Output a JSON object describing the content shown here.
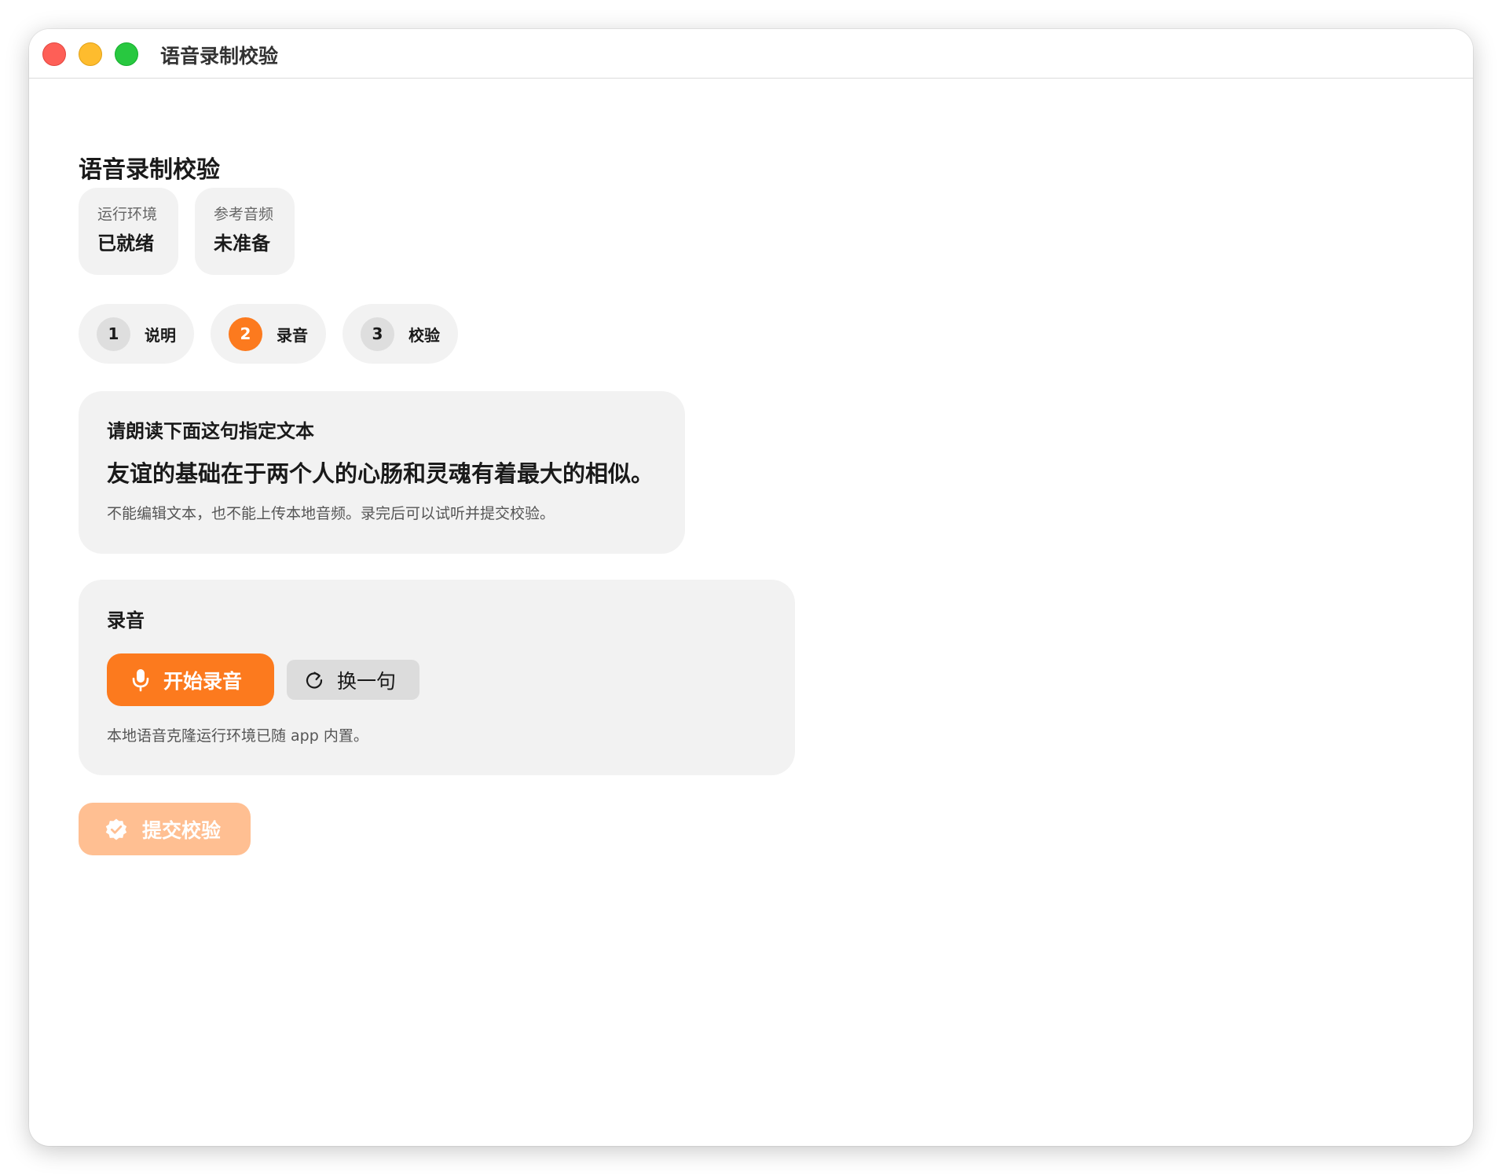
{
  "window": {
    "title": "语音录制校验"
  },
  "page": {
    "title": "语音录制校验"
  },
  "status": [
    {
      "label": "运行环境",
      "value": "已就绪"
    },
    {
      "label": "参考音频",
      "value": "未准备"
    }
  ],
  "steps": [
    {
      "number": "1",
      "label": "说明",
      "active": false
    },
    {
      "number": "2",
      "label": "录音",
      "active": true
    },
    {
      "number": "3",
      "label": "校验",
      "active": false
    }
  ],
  "prompt": {
    "heading": "请朗读下面这句指定文本",
    "sentence": "友谊的基础在于两个人的心肠和灵魂有着最大的相似。",
    "note": "不能编辑文本，也不能上传本地音频。录完后可以试听并提交校验。"
  },
  "recording": {
    "heading": "录音",
    "start_label": "开始录音",
    "change_label": "换一句",
    "note": "本地语音克隆运行环境已随 app 内置。"
  },
  "submit": {
    "label": "提交校验",
    "enabled": false
  },
  "colors": {
    "accent": "#fc7a1e",
    "accent_disabled": "#ffbf92",
    "panel": "#f2f2f2"
  },
  "icons": {
    "start": "microphone-icon",
    "change": "refresh-icon",
    "submit": "verified-check-icon"
  }
}
